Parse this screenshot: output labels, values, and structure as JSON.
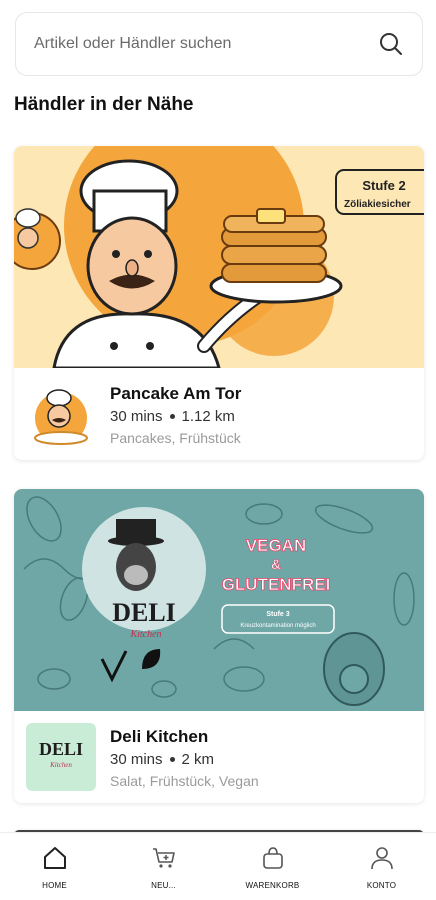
{
  "search": {
    "placeholder": "Artikel oder Händler suchen"
  },
  "section_title": "Händler in der Nähe",
  "merchants": [
    {
      "name": "Pancake Am Tor",
      "time": "30 mins",
      "distance": "1.12 km",
      "tags": "Pancakes, Frühstück",
      "badge": "Stufe 2",
      "badge_sub": "Zöliakiesicher"
    },
    {
      "name": "Deli Kitchen",
      "time": "30 mins",
      "distance": "2 km",
      "tags": "Salat, Frühstück, Vegan",
      "banner_title_1": "VEGAN",
      "banner_amp": "&",
      "banner_title_2": "GLUTENFREI",
      "banner_badge_1": "Stufe 3",
      "banner_badge_2": "Kreuzkontamination möglich",
      "logo_text": "DELI",
      "logo_sub": "Kitchen"
    }
  ],
  "nav": [
    {
      "label": "HOME",
      "icon": "home-icon"
    },
    {
      "label": "NEU...",
      "icon": "cart-icon"
    },
    {
      "label": "WARENKORB",
      "icon": "bag-icon"
    },
    {
      "label": "KONTO",
      "icon": "user-icon"
    }
  ],
  "colors": {
    "pancake_bg": "#fde7b5",
    "pancake_orange": "#f4a53b",
    "deli_bg": "#6fa7a6",
    "deli_logo_bg": "#c9ecd6",
    "banner_red": "#e8456b"
  }
}
